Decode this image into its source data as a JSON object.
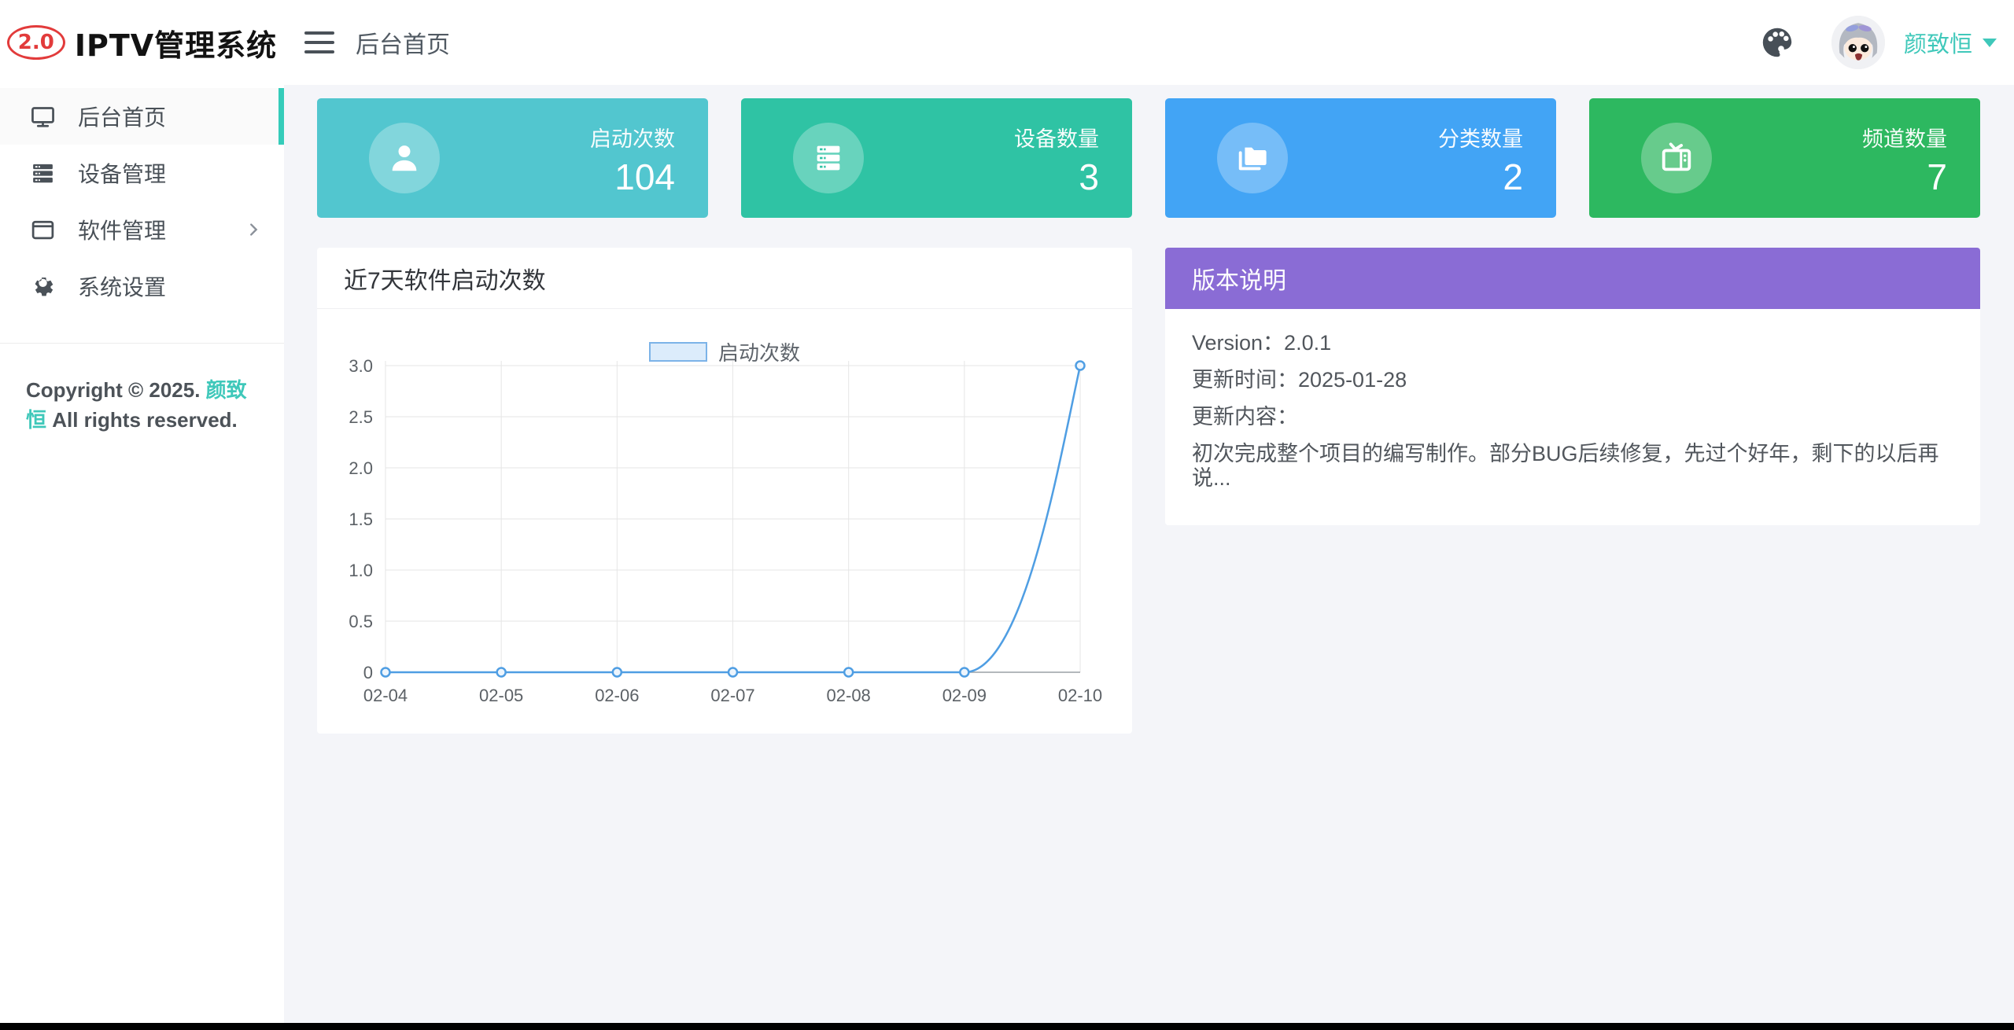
{
  "app": {
    "logo_badge": "2.0",
    "logo_title": "IPTV管理系统"
  },
  "theme": {
    "accent_teal": "#35CCBA",
    "line_blue": "#4F9EE3",
    "background": "#F4F5F9"
  },
  "topbar": {
    "breadcrumb": "后台首页",
    "username": "颜致恒"
  },
  "sidebar": {
    "items": [
      {
        "label": "后台首页",
        "icon": "monitor-icon",
        "active": true
      },
      {
        "label": "设备管理",
        "icon": "server-icon",
        "active": false
      },
      {
        "label": "软件管理",
        "icon": "window-icon",
        "active": false,
        "has_submenu": true
      },
      {
        "label": "系统设置",
        "icon": "gear-icon",
        "active": false
      }
    ],
    "copyright_prefix": "Copyright © 2025. ",
    "copyright_owner": "颜致恒",
    "copyright_suffix": " All rights reserved."
  },
  "stat_cards": [
    {
      "label": "启动次数",
      "value": "104",
      "color": "#52C6CF",
      "icon": "user-icon"
    },
    {
      "label": "设备数量",
      "value": "3",
      "color": "#2FC3A4",
      "icon": "server-stack-icon"
    },
    {
      "label": "分类数量",
      "value": "2",
      "color": "#42A4F5",
      "icon": "folders-icon"
    },
    {
      "label": "频道数量",
      "value": "7",
      "color": "#2DB860",
      "icon": "tv-icon"
    }
  ],
  "chart_card": {
    "title": "近7天软件启动次数"
  },
  "chart_data": {
    "type": "line",
    "title": "近7天软件启动次数",
    "series_name": "启动次数",
    "categories": [
      "02-04",
      "02-05",
      "02-06",
      "02-07",
      "02-08",
      "02-09",
      "02-10"
    ],
    "values": [
      0,
      0,
      0,
      0,
      0,
      0,
      3
    ],
    "xlabel": "",
    "ylabel": "",
    "ylim": [
      0,
      3
    ],
    "y_tick_labels": [
      "0",
      "0.5",
      "1.0",
      "1.5",
      "2.0",
      "2.5",
      "3.0"
    ],
    "grid": true,
    "smooth": true,
    "legend_position": "top-center"
  },
  "version_card": {
    "title": "版本说明",
    "header_color": "#8A6CD5",
    "rows": [
      "Version：2.0.1",
      "更新时间：2025-01-28",
      "更新内容：",
      "初次完成整个项目的编写制作。部分BUG后续修复，先过个好年，剩下的以后再说..."
    ]
  }
}
